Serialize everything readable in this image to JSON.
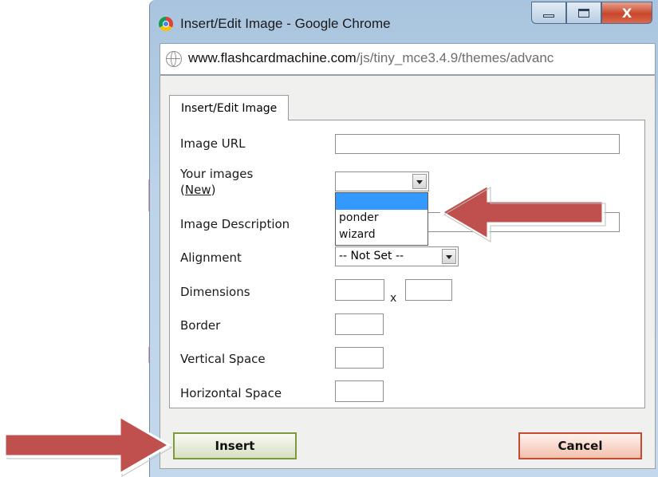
{
  "window": {
    "title": "Insert/Edit Image - Google Chrome",
    "controls": {
      "minimize": "",
      "maximize": "",
      "close": "X"
    }
  },
  "address_bar": {
    "host": "www.flashcardmachine.com",
    "path": "/js/tiny_mce3.4.9/themes/advanc"
  },
  "dialog": {
    "tab_label": "Insert/Edit Image",
    "fields": {
      "image_url": {
        "label": "Image URL",
        "value": ""
      },
      "your_images": {
        "label": "Your images",
        "new_link": "New",
        "open_paren": "(",
        "close_paren": ")",
        "selected": ""
      },
      "image_description": {
        "label": "Image Description",
        "value": ""
      },
      "alignment": {
        "label": "Alignment",
        "selected": "-- Not Set --"
      },
      "dimensions": {
        "label": "Dimensions",
        "separator": "x",
        "width": "",
        "height": ""
      },
      "border": {
        "label": "Border",
        "value": ""
      },
      "vertical_space": {
        "label": "Vertical Space",
        "value": ""
      },
      "horizontal_space": {
        "label": "Horizontal Space",
        "value": ""
      }
    },
    "images_dropdown_options": [
      "",
      "ponder",
      "wizard"
    ],
    "buttons": {
      "insert": "Insert",
      "cancel": "Cancel"
    }
  },
  "colors": {
    "annotation_arrow": "#c0504d",
    "highlight": "#3399ff",
    "close_button": "#c8462b"
  }
}
